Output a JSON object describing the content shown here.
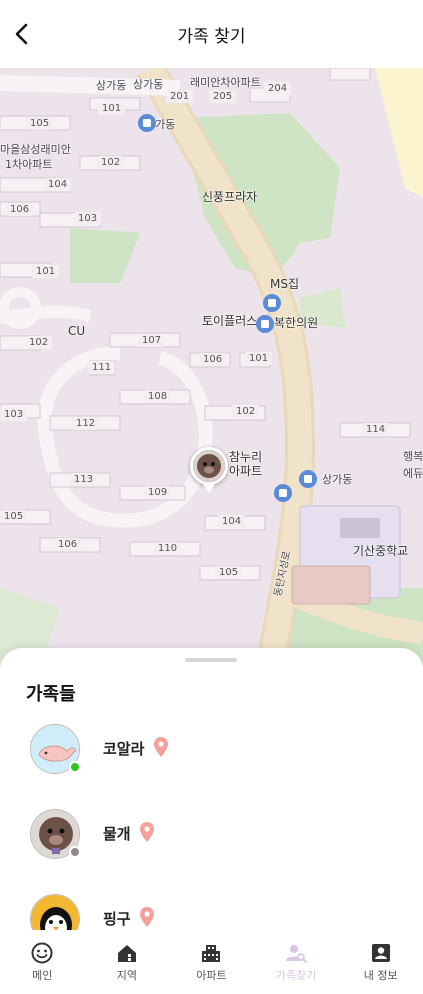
{
  "header": {
    "title": "가족 찾기"
  },
  "map": {
    "labels": {
      "shop1": "상가동",
      "shop2": "상가동",
      "shop3": "상가동",
      "shop4": "상가동",
      "apt_top": "래미안차아파트",
      "apt_left_1": "마을삼성래미안",
      "apt_left_2": "1차아파트",
      "plaza": "신풍프라자",
      "ms": "MS집",
      "toy": "토이플러스",
      "clinic": "복한의원",
      "cu": "CU",
      "chamnuri_1": "참누리",
      "chamnuri_2": "아파트",
      "school": "기산중학교",
      "haengbok": "행복",
      "edu": "에듀",
      "road": "동탄지성로"
    },
    "buildings": {
      "b201": "201",
      "b205": "205",
      "b204": "204",
      "b101a": "101",
      "b105a": "105",
      "b102a": "102",
      "b104a": "104",
      "b106a": "106",
      "b103a": "103",
      "b101b": "101",
      "b102b": "102",
      "b107": "107",
      "b106b": "106",
      "b101c": "101",
      "b111": "111",
      "b108": "108",
      "b102c": "102",
      "b103b": "103",
      "b112": "112",
      "b114": "114",
      "b113": "113",
      "b109": "109",
      "b104b": "104",
      "b105b": "105",
      "b110": "110",
      "b106c": "106",
      "b105c": "105"
    }
  },
  "sheet": {
    "title": "가족들",
    "members": [
      {
        "name": "코알라",
        "status_color": "#2ec41f"
      },
      {
        "name": "물개",
        "status_color": "#8a8a8a"
      },
      {
        "name": "핑구",
        "status_color": "#8a8a8a"
      }
    ]
  },
  "tabs": [
    {
      "label": "메인",
      "icon": "smile-icon"
    },
    {
      "label": "지역",
      "icon": "home-icon"
    },
    {
      "label": "아파트",
      "icon": "apartment-icon"
    },
    {
      "label": "가족찾기",
      "icon": "family-search-icon",
      "active": true
    },
    {
      "label": "내 정보",
      "icon": "profile-icon"
    }
  ],
  "colors": {
    "accent": "#d9c6e6",
    "pin": "#f4a19b",
    "road": "#e9d8b9",
    "park": "#cfe3c5"
  }
}
